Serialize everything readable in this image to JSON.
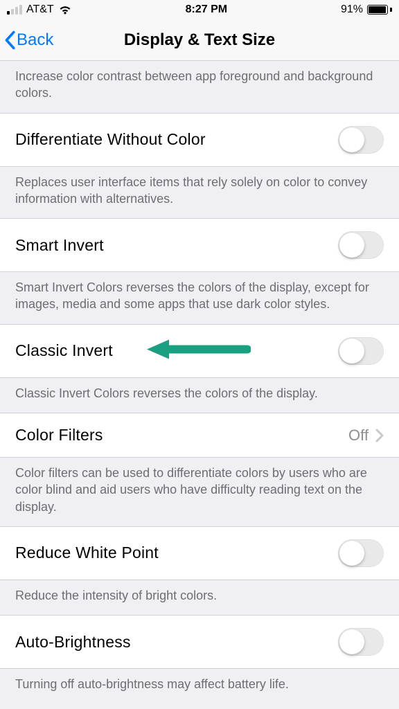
{
  "status": {
    "carrier": "AT&T",
    "time": "8:27 PM",
    "battery_pct": "91%"
  },
  "nav": {
    "back_label": "Back",
    "title": "Display & Text Size"
  },
  "sections": {
    "increase_contrast_footer": "Increase color contrast between app foreground and background colors.",
    "diff_without_color": {
      "label": "Differentiate Without Color",
      "footer": "Replaces user interface items that rely solely on color to convey information with alternatives."
    },
    "smart_invert": {
      "label": "Smart Invert",
      "footer": "Smart Invert Colors reverses the colors of the display, except for images, media and some apps that use dark color styles."
    },
    "classic_invert": {
      "label": "Classic Invert",
      "footer": "Classic Invert Colors reverses the colors of the display."
    },
    "color_filters": {
      "label": "Color Filters",
      "value": "Off",
      "footer": "Color filters can be used to differentiate colors by users who are color blind and aid users who have difficulty reading text on the display."
    },
    "reduce_white_point": {
      "label": "Reduce White Point",
      "footer": "Reduce the intensity of bright colors."
    },
    "auto_brightness": {
      "label": "Auto-Brightness",
      "footer": "Turning off auto-brightness may affect battery life."
    }
  },
  "annotation": {
    "arrow_color": "#1aa080"
  }
}
